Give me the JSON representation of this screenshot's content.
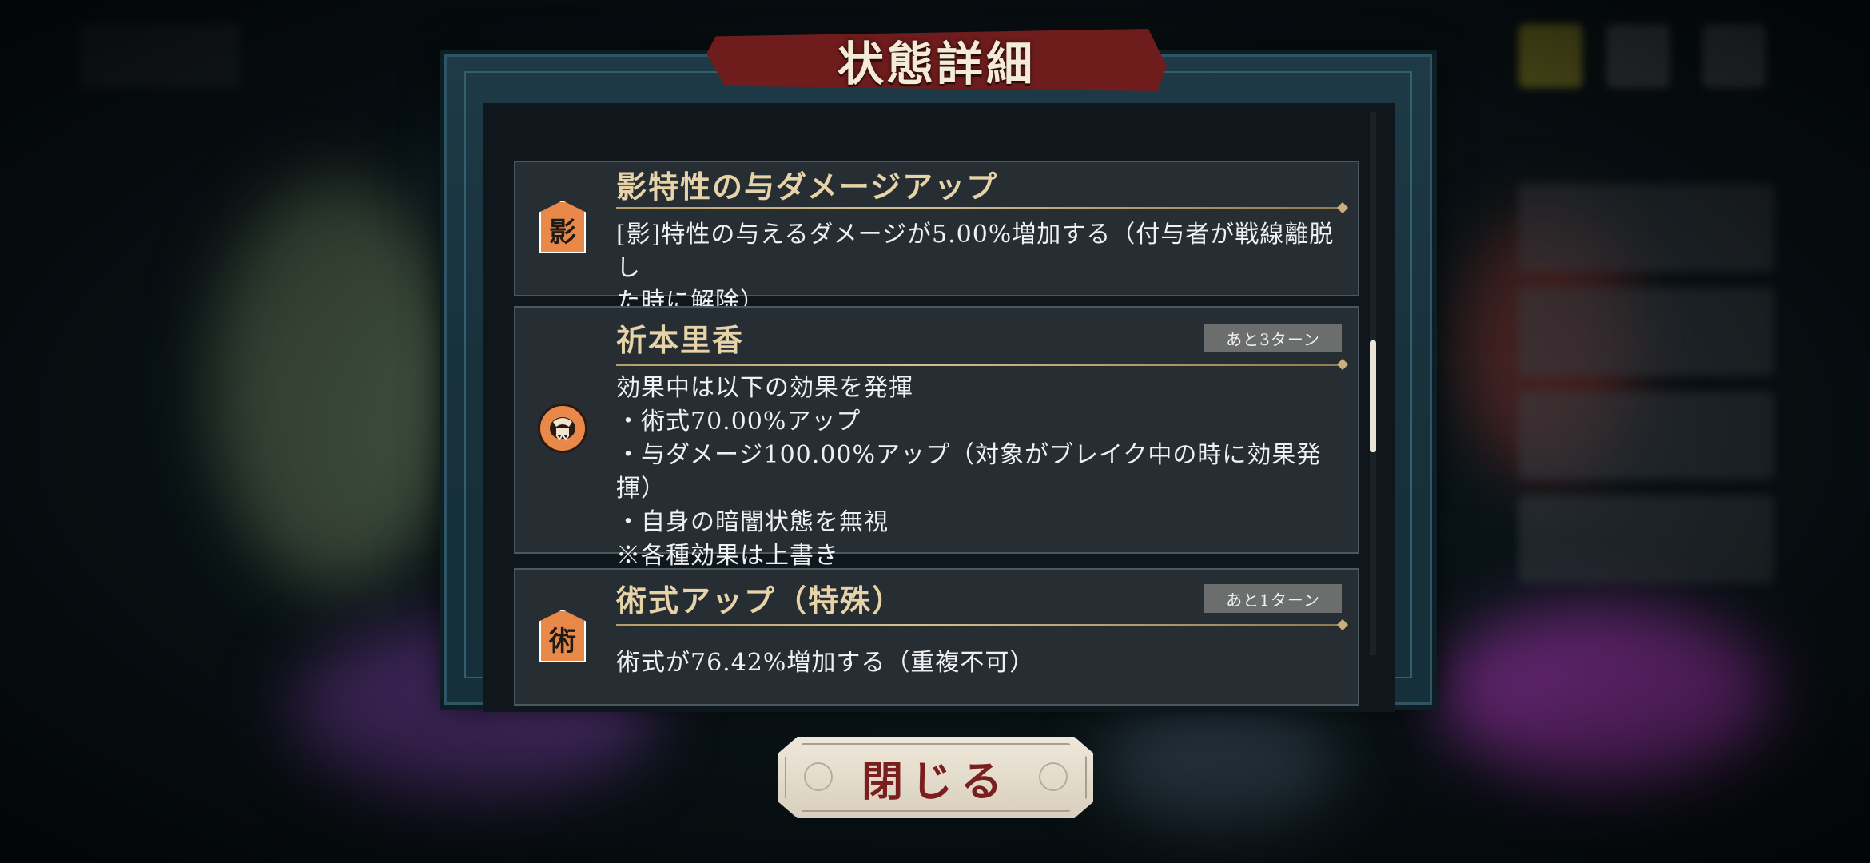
{
  "dialog": {
    "title": "状態詳細",
    "close_label": "閉じる"
  },
  "effects": [
    {
      "icon": "shadow-attribute-icon",
      "icon_glyph": "影",
      "title": "影特性の与ダメージアップ",
      "turns": "",
      "lines": [
        "[影]特性の与えるダメージが5.00%増加する（付与者が戦線離脱し",
        "た時に解除）"
      ]
    },
    {
      "icon": "rika-orimoto-icon",
      "title": "祈本里香",
      "turns": "あと3ターン",
      "lines": [
        "効果中は以下の効果を発揮",
        "・術式70.00%アップ",
        "・与ダメージ100.00%アップ（対象がブレイク中の時に効果発揮）",
        "・自身の暗闇状態を無視",
        "※各種効果は上書き"
      ]
    },
    {
      "icon": "jutsushiki-icon",
      "icon_glyph": "術",
      "title": "術式アップ（特殊）",
      "turns": "あと1ターン",
      "lines": [
        "術式が76.42%増加する（重複不可）"
      ]
    }
  ],
  "colors": {
    "accent_gold": "#e6d3a8",
    "banner_red": "#6e1c1c",
    "icon_orange": "#e8894a",
    "close_text": "#7a1e1e"
  }
}
